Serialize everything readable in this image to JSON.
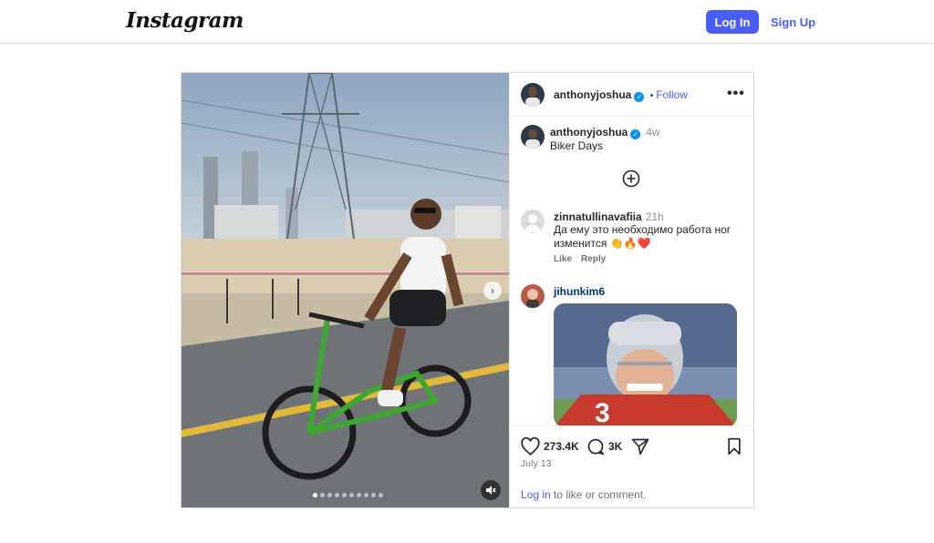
{
  "header": {
    "logo": "Instagram",
    "login_label": "Log In",
    "signup_label": "Sign Up"
  },
  "post": {
    "author": "anthonyjoshua",
    "follow_label": "Follow",
    "separator": "•",
    "caption_author": "anthonyjoshua",
    "caption_time": "4w",
    "caption": "Biker Days",
    "media_dots": 10,
    "media_active_dot": 0
  },
  "comments": [
    {
      "user": "zinnatullinavafiia",
      "time": "21h",
      "text": "Да ему это необходимо работа ног изменится 👏🔥❤️",
      "like_label": "Like",
      "reply_label": "Reply"
    },
    {
      "user": "jihunkim6",
      "attachment": "gif"
    }
  ],
  "actions": {
    "likes": "273.4K",
    "comments": "3K",
    "date": "July 13"
  },
  "login_prompt": {
    "link": "Log in",
    "rest": " to like or comment."
  },
  "colors": {
    "accent": "#4a5df9",
    "verified": "#0095f6",
    "border": "#dbdbdb"
  },
  "icons": [
    "heart-icon",
    "comment-icon",
    "share-icon",
    "bookmark-icon",
    "more-icon",
    "add-circle-icon",
    "chevron-right-icon",
    "mute-icon",
    "verified-icon"
  ]
}
